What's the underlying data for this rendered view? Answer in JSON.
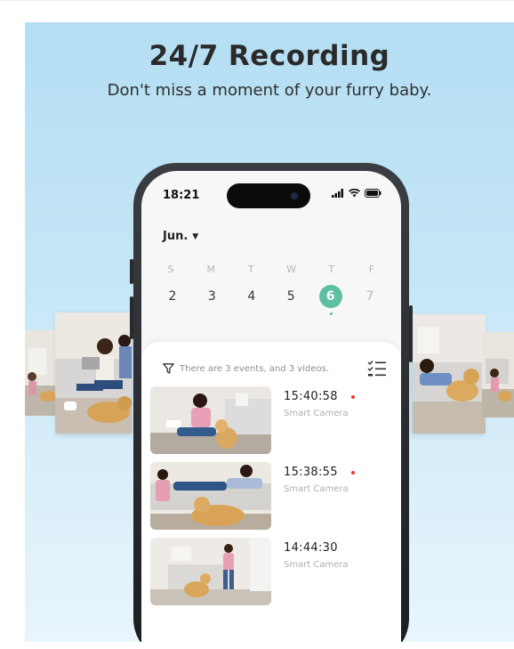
{
  "banner": {
    "headline": "24/7 Recording",
    "subline": "Don't miss a moment of your furry baby."
  },
  "phone": {
    "status_time": "18:21",
    "month_label": "Jun.",
    "weekdays": [
      "S",
      "M",
      "T",
      "W",
      "T",
      "F"
    ],
    "dates": [
      "2",
      "3",
      "4",
      "5",
      "6",
      "7"
    ],
    "selected_date": "6",
    "event_summary": "There are 3 events, and 3 videos.",
    "events": [
      {
        "time": "15:40:58",
        "source": "Smart Camera",
        "unread": true
      },
      {
        "time": "15:38:55",
        "source": "Smart Camera",
        "unread": true
      },
      {
        "time": "14:44:30",
        "source": "Smart Camera",
        "unread": false
      }
    ]
  },
  "colors": {
    "accent": "#5ec0a2",
    "unread_dot": "#e53935",
    "background_top": "#b4def3",
    "background_bottom": "#e8f5fc"
  },
  "icons": [
    "filter-icon",
    "list-check-icon",
    "signal-icon",
    "wifi-icon",
    "battery-icon",
    "chevron-down-icon"
  ]
}
